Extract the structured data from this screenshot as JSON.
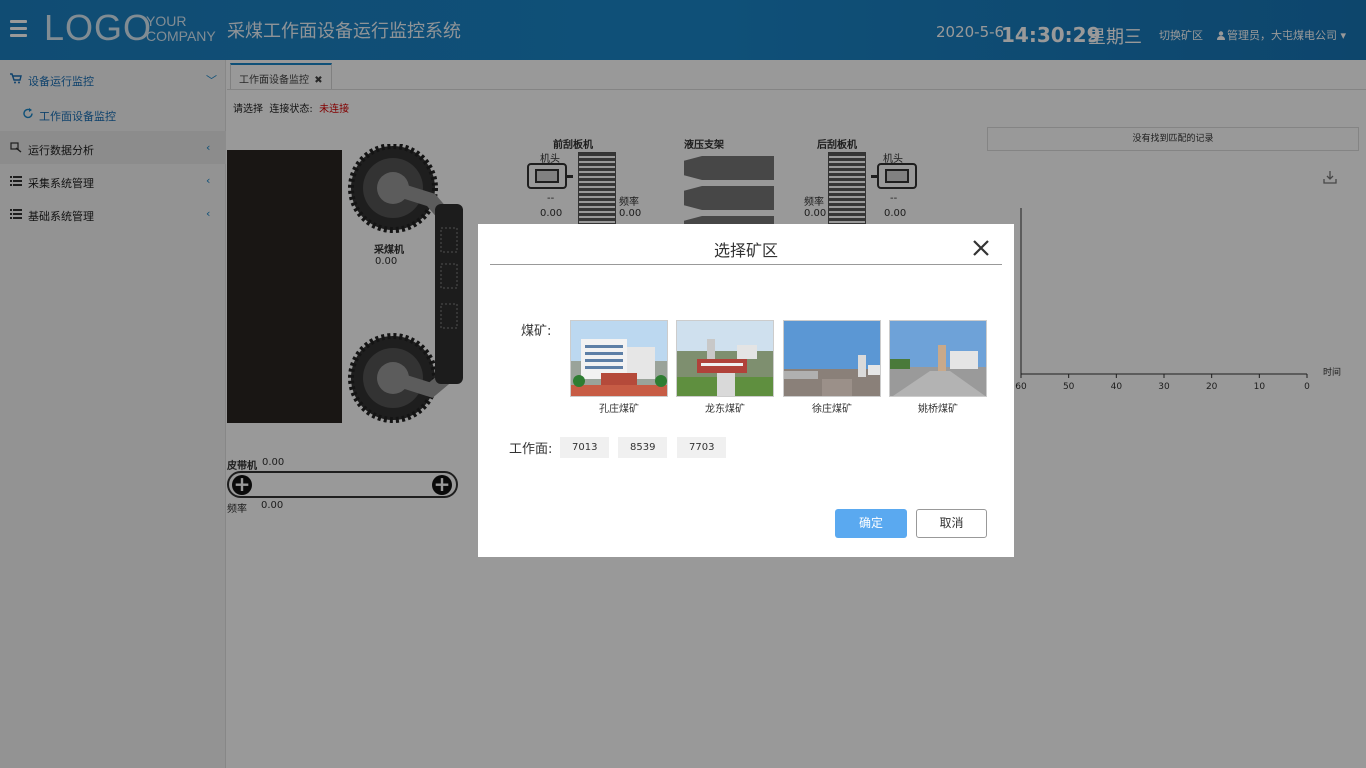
{
  "header": {
    "logo_main": "LOGO",
    "logo_sub_1": "YOUR",
    "logo_sub_2": "COMPANY",
    "title": "采煤工作面设备运行监控系统",
    "date": "2020-5-6",
    "time": "14:30:29",
    "weekday": "星期三",
    "switch_label": "切换矿区",
    "user_label": "管理员，大屯煤电公司",
    "bg_color": "#1a86c9"
  },
  "sidebar": {
    "items": [
      {
        "label": "设备运行监控",
        "icon": "cart-icon",
        "chevron": "chevron-down-icon"
      },
      {
        "label": "工作面设备监控",
        "icon": "refresh-icon"
      },
      {
        "label": "运行数据分析",
        "icon": "analysis-icon",
        "chevron": "chevron-left-icon"
      },
      {
        "label": "采集系统管理",
        "icon": "list-icon",
        "chevron": "chevron-left-icon"
      },
      {
        "label": "基础系统管理",
        "icon": "list-icon",
        "chevron": "chevron-left-icon"
      }
    ]
  },
  "tabs": [
    {
      "label": "工作面设备监控"
    }
  ],
  "status": {
    "prefix": "请选择",
    "label": "连接状态:",
    "value": "未连接",
    "value_color": "#d90000"
  },
  "monitor": {
    "shearer_label": "采煤机",
    "shearer_value": "0.00",
    "front_conveyor_label": "前刮板机",
    "hydraulic_label": "液压支架",
    "rear_conveyor_label": "后刮板机",
    "head_label_left": "机头",
    "head_label_right": "机头",
    "front_dash": "--",
    "front_value": "0.00",
    "front_freq_label": "频率",
    "front_freq_value": "0.00",
    "rear_freq_label": "频率",
    "rear_freq_value": "0.00",
    "rear_dash": "--",
    "rear_value": "0.00",
    "belt_label": "皮带机",
    "belt_value": "0.00",
    "belt_freq_label": "频率",
    "belt_freq_value": "0.00",
    "no_record": "没有找到匹配的记录",
    "chart_x_ticks": [
      "60",
      "50",
      "40",
      "30",
      "20",
      "10",
      "0"
    ],
    "chart_xlabel": "时间"
  },
  "modal": {
    "title": "选择矿区",
    "mine_label": "煤矿:",
    "mines": [
      {
        "name": "孔庄煤矿"
      },
      {
        "name": "龙东煤矿"
      },
      {
        "name": "徐庄煤矿"
      },
      {
        "name": "姚桥煤矿"
      }
    ],
    "face_label": "工作面:",
    "faces": [
      "7013",
      "8539",
      "7703"
    ],
    "ok_label": "确定",
    "cancel_label": "取消",
    "ok_color": "#5aa9f0"
  }
}
